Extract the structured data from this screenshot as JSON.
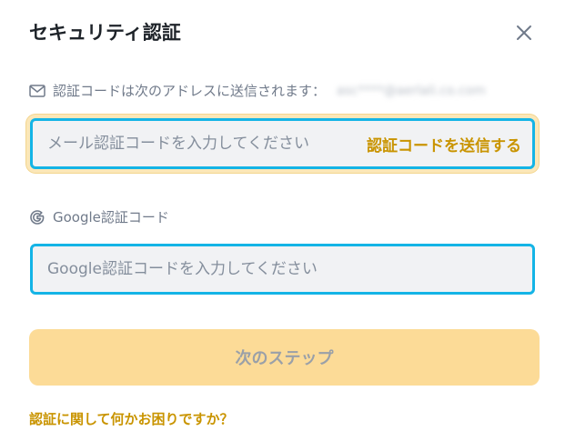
{
  "dialog": {
    "title": "セキュリティ認証",
    "close_icon": "close-icon"
  },
  "email_section": {
    "label": "認証コードは次のアドレスに送信されます：",
    "masked_email": "asc****@aerlali.co.com",
    "icon": "mail-icon",
    "input_placeholder": "メール認証コードを入力してください",
    "input_value": "",
    "send_code_label": "認証コードを送信する"
  },
  "google_section": {
    "label": "Google認証コード",
    "icon": "google-icon",
    "input_placeholder": "Google認証コードを入力してください",
    "input_value": ""
  },
  "actions": {
    "next_label": "次のステップ",
    "help_label": "認証に関して何かお困りですか？"
  },
  "colors": {
    "accent": "#c99400",
    "focus_border": "#14b4e6",
    "button_disabled_bg": "#fcdb97"
  }
}
